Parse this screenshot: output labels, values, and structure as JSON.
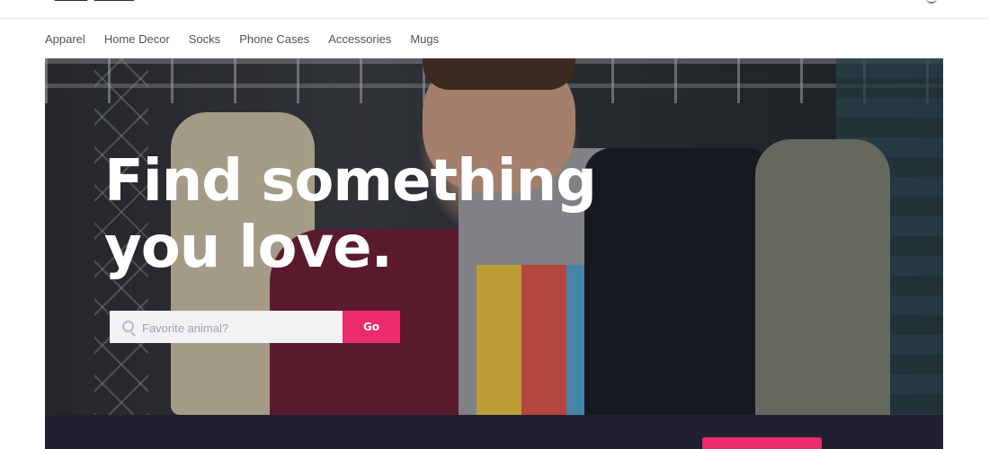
{
  "header": {
    "logo_alt": "store logo"
  },
  "category_nav": [
    {
      "label": "Apparel"
    },
    {
      "label": "Home Decor"
    },
    {
      "label": "Socks"
    },
    {
      "label": "Phone Cases"
    },
    {
      "label": "Accessories"
    },
    {
      "label": "Mugs"
    }
  ],
  "hero": {
    "title": "Find something\nyou love.",
    "search": {
      "placeholder": "Favorite animal?",
      "value": "",
      "button_label": "Go"
    }
  },
  "colors": {
    "accent": "#ee2a6c",
    "band": "#22202f",
    "nav_text": "#52525c"
  }
}
